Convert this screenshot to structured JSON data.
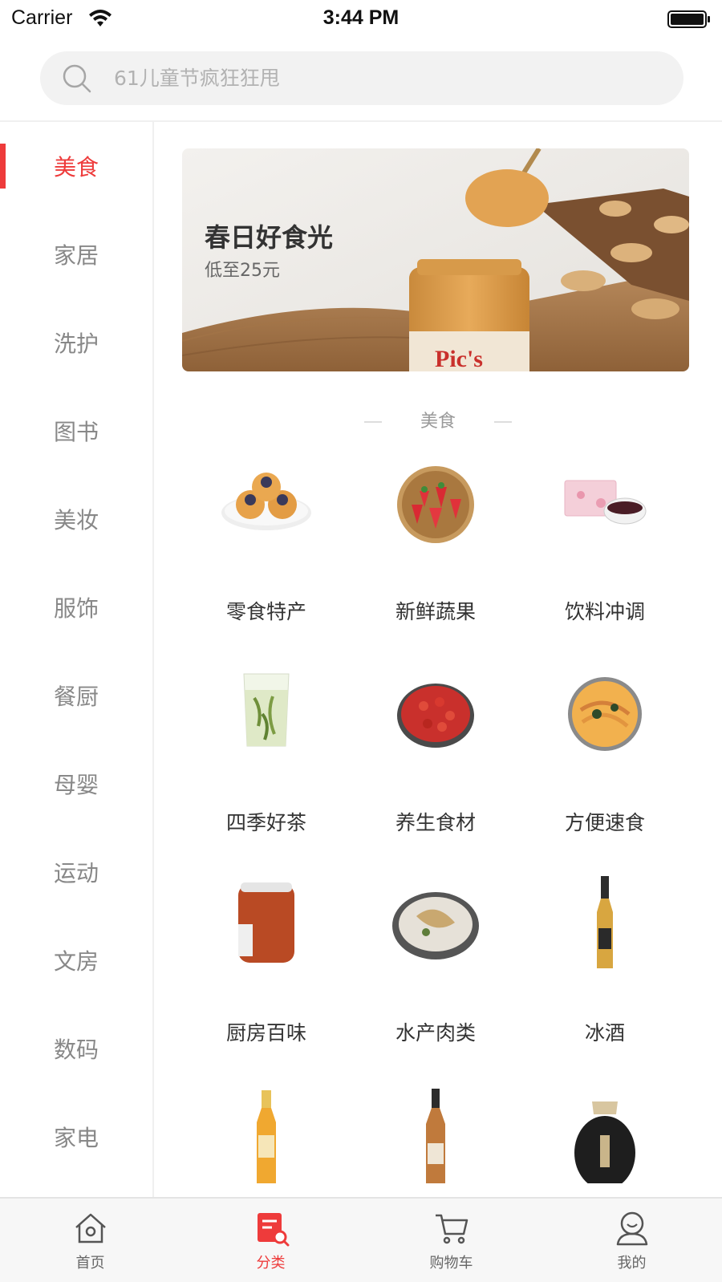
{
  "status_bar": {
    "carrier": "Carrier",
    "time": "3:44 PM"
  },
  "search": {
    "placeholder": "61儿童节疯狂狂甩"
  },
  "sidebar": {
    "items": [
      {
        "label": "美食",
        "active": true
      },
      {
        "label": "家居"
      },
      {
        "label": "洗护"
      },
      {
        "label": "图书"
      },
      {
        "label": "美妆"
      },
      {
        "label": "服饰"
      },
      {
        "label": "餐厨"
      },
      {
        "label": "母婴"
      },
      {
        "label": "运动"
      },
      {
        "label": "文房"
      },
      {
        "label": "数码"
      },
      {
        "label": "家电"
      }
    ]
  },
  "banner": {
    "title": "春日好食光",
    "subtitle": "低至25元",
    "brand": "Pic's"
  },
  "section": {
    "title": "美食"
  },
  "categories": [
    {
      "label": "零食特产",
      "icon": "pastry-plate-image"
    },
    {
      "label": "新鲜蔬果",
      "icon": "strawberry-basket-image"
    },
    {
      "label": "饮料冲调",
      "icon": "tea-box-cup-image"
    },
    {
      "label": "四季好茶",
      "icon": "green-tea-glass-image"
    },
    {
      "label": "养生食材",
      "icon": "goji-berry-bowl-image"
    },
    {
      "label": "方便速食",
      "icon": "noodle-bowl-image"
    },
    {
      "label": "厨房百味",
      "icon": "sauce-jar-image"
    },
    {
      "label": "水产肉类",
      "icon": "fish-pot-image"
    },
    {
      "label": "冰酒",
      "icon": "ice-wine-bottle-image"
    },
    {
      "label": "",
      "icon": "amber-bottle-image"
    },
    {
      "label": "",
      "icon": "wine-bottle-image"
    },
    {
      "label": "",
      "icon": "black-liquor-jar-image"
    }
  ],
  "tab_bar": {
    "tabs": [
      {
        "label": "首页",
        "icon": "home-icon"
      },
      {
        "label": "分类",
        "icon": "category-icon",
        "active": true
      },
      {
        "label": "购物车",
        "icon": "cart-icon"
      },
      {
        "label": "我的",
        "icon": "profile-icon"
      }
    ]
  },
  "colors": {
    "accent": "#ee3b3b",
    "text": "#333333",
    "muted": "#888888"
  }
}
